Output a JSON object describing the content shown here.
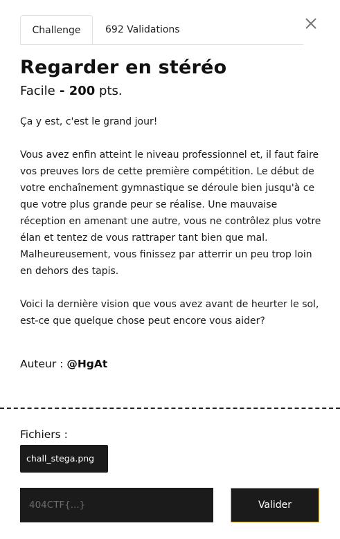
{
  "tabs": [
    {
      "label": "Challenge",
      "active": true
    },
    {
      "label": "692 Validations",
      "active": false
    }
  ],
  "close_icon": "close-icon",
  "challenge": {
    "title": "Regarder en stéréo",
    "difficulty": "Facile",
    "separator": " - ",
    "points": "200",
    "points_unit": " pts.",
    "description": [
      "Ça y est, c'est le grand jour!",
      "Vous avez enfin atteint le niveau professionnel et, il faut faire vos preuves lors de cette première compétition. Le début de votre enchaînement gymnastique se déroule bien jusqu'à ce que votre plus grande peur se réalise. Une mauvaise réception en amenant une autre, vous ne contrôlez plus votre élan et tentez de vous rattraper tant bien que mal. Malheureusement, vous finissez par atterrir un peu trop loin en dehors des tapis.",
      "Voici la dernière vision que vous avez avant de heurter le sol, est-ce que quelque chose peut encore vous aider?"
    ],
    "author_label": "Auteur : ",
    "author": "@HgAt"
  },
  "files": {
    "label": "Fichiers :",
    "items": [
      "chall_stega.png"
    ]
  },
  "flag": {
    "placeholder": "404CTF{...}",
    "value": "",
    "submit_label": "Valider"
  },
  "colors": {
    "background": "#ffffff",
    "dark": "#1b1b1b",
    "accent_border": "#d4a437"
  }
}
